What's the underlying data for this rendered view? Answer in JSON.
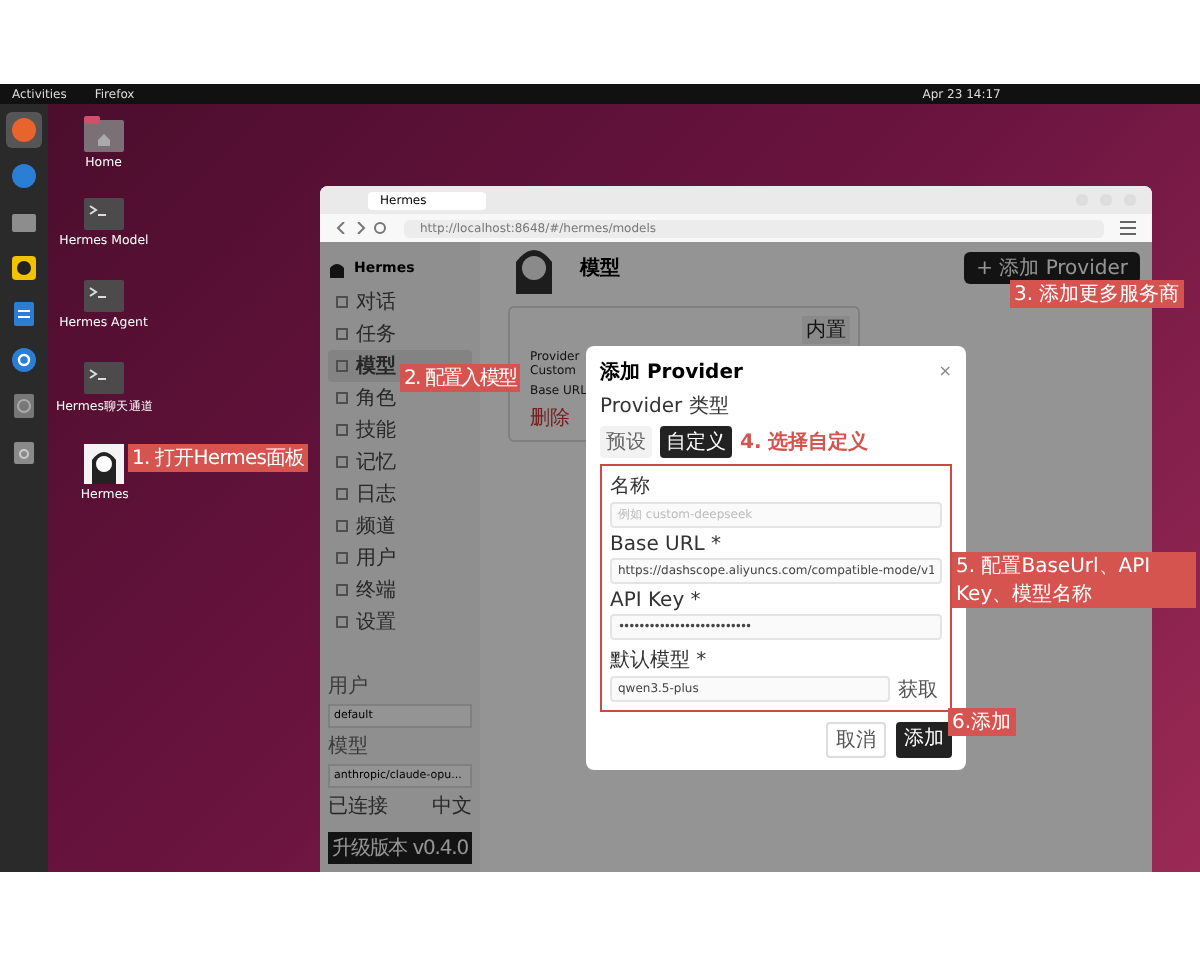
{
  "top_bar": {
    "activities": "Activities",
    "app": "Firefox",
    "clock": "Apr 23 14:17"
  },
  "dock": [
    {
      "kind": "browser",
      "selected": true
    },
    {
      "kind": "mail",
      "selected": false
    },
    {
      "kind": "files",
      "selected": false
    },
    {
      "kind": "music",
      "selected": false
    },
    {
      "kind": "writer",
      "selected": false
    },
    {
      "kind": "help",
      "selected": false
    },
    {
      "kind": "disk",
      "selected": false
    },
    {
      "kind": "trash",
      "selected": false
    }
  ],
  "desktop_icons": [
    {
      "label": "Home",
      "kind": "folder"
    },
    {
      "label": "Hermes Model",
      "kind": "terminal"
    },
    {
      "label": "Hermes Agent",
      "kind": "terminal"
    },
    {
      "label": "Hermes聊天通道",
      "kind": "terminal"
    },
    {
      "label": "Hermes",
      "kind": "avatar"
    }
  ],
  "browser": {
    "tab_title": "Hermes",
    "url": "http://localhost:8648/#/hermes/models"
  },
  "app": {
    "brand": "Hermes",
    "page_title": "模型",
    "add_button": "+ 添加 Provider",
    "nav": [
      {
        "label": "对话",
        "selected": false
      },
      {
        "label": "任务",
        "selected": false
      },
      {
        "label": "模型",
        "selected": true
      },
      {
        "label": "角色",
        "selected": false
      },
      {
        "label": "技能",
        "selected": false
      },
      {
        "label": "记忆",
        "selected": false
      },
      {
        "label": "日志",
        "selected": false
      },
      {
        "label": "频道",
        "selected": false
      },
      {
        "label": "用户",
        "selected": false
      },
      {
        "label": "终端",
        "selected": false
      },
      {
        "label": "设置",
        "selected": false
      }
    ],
    "user_label": "用户",
    "user_value": "default",
    "model_label": "模型",
    "model_value": "anthropic/claude-opu...",
    "status": "已连接",
    "language": "中文",
    "version_button": "升级版本 v0.4.0",
    "card": {
      "tag": "内置",
      "rows": [
        {
          "label": "Provider",
          "value": "Custom"
        },
        {
          "label": "Base URL"
        }
      ],
      "delete": "删除"
    }
  },
  "modal": {
    "title": "添加 Provider",
    "close": "×",
    "type_label": "Provider 类型",
    "type_options": [
      {
        "label": "预设",
        "selected": false
      },
      {
        "label": "自定义",
        "selected": true
      }
    ],
    "fields": [
      {
        "label": "名称",
        "placeholder": "例如 custom-deepseek",
        "kind": "text"
      },
      {
        "label": "Base URL *",
        "value": "https://dashscope.aliyuncs.com/compatible-mode/v1",
        "kind": "text"
      },
      {
        "label": "API Key *",
        "value": "••••••••••••••••••••••••••",
        "kind": "password"
      },
      {
        "label": "默认模型 *",
        "value": "qwen3.5-plus",
        "kind": "model",
        "action": "获取"
      }
    ],
    "cancel": "取消",
    "submit": "添加"
  },
  "annotations": [
    "1. 打开Hermes面板",
    "2. 配置入模型",
    "3. 添加更多服务商",
    "4. 选择自定义",
    "5. 配置BaseUrl、API Key、模型名称",
    "6.添加"
  ]
}
